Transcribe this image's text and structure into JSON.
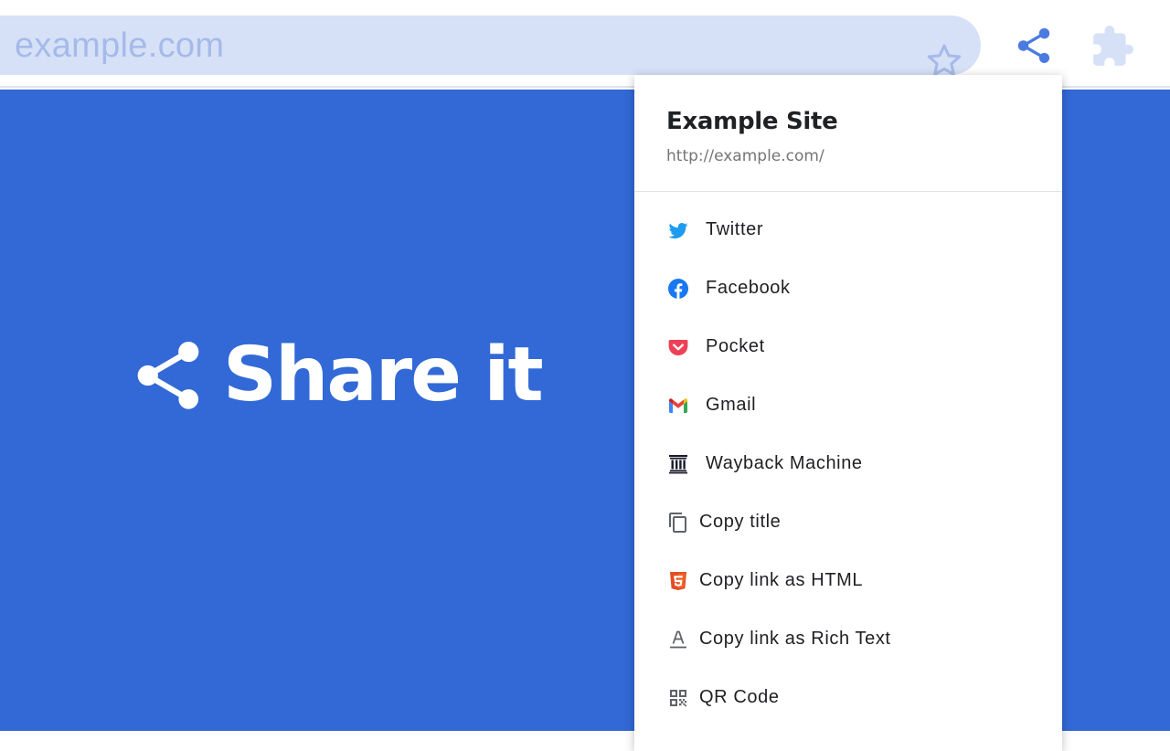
{
  "browser": {
    "address_text": "example.com",
    "bookmark_icon": "star-outline-icon",
    "share_icon": "share-icon",
    "extensions_icon": "puzzle-icon",
    "accent_color": "#4b7be0"
  },
  "hero": {
    "title": "Share it",
    "icon": "share-icon",
    "background_color": "#3269d6"
  },
  "popup": {
    "site_title": "Example Site",
    "site_url": "http://example.com/",
    "items": [
      {
        "label": "Twitter",
        "icon": "twitter-icon"
      },
      {
        "label": "Facebook",
        "icon": "facebook-icon"
      },
      {
        "label": "Pocket",
        "icon": "pocket-icon"
      },
      {
        "label": "Gmail",
        "icon": "gmail-icon"
      },
      {
        "label": "Wayback Machine",
        "icon": "wayback-machine-icon"
      },
      {
        "label": "Copy title",
        "icon": "copy-icon"
      },
      {
        "label": "Copy link as HTML",
        "icon": "html5-icon"
      },
      {
        "label": "Copy link as Rich Text",
        "icon": "text-format-icon"
      },
      {
        "label": "QR Code",
        "icon": "qr-code-icon"
      }
    ]
  }
}
